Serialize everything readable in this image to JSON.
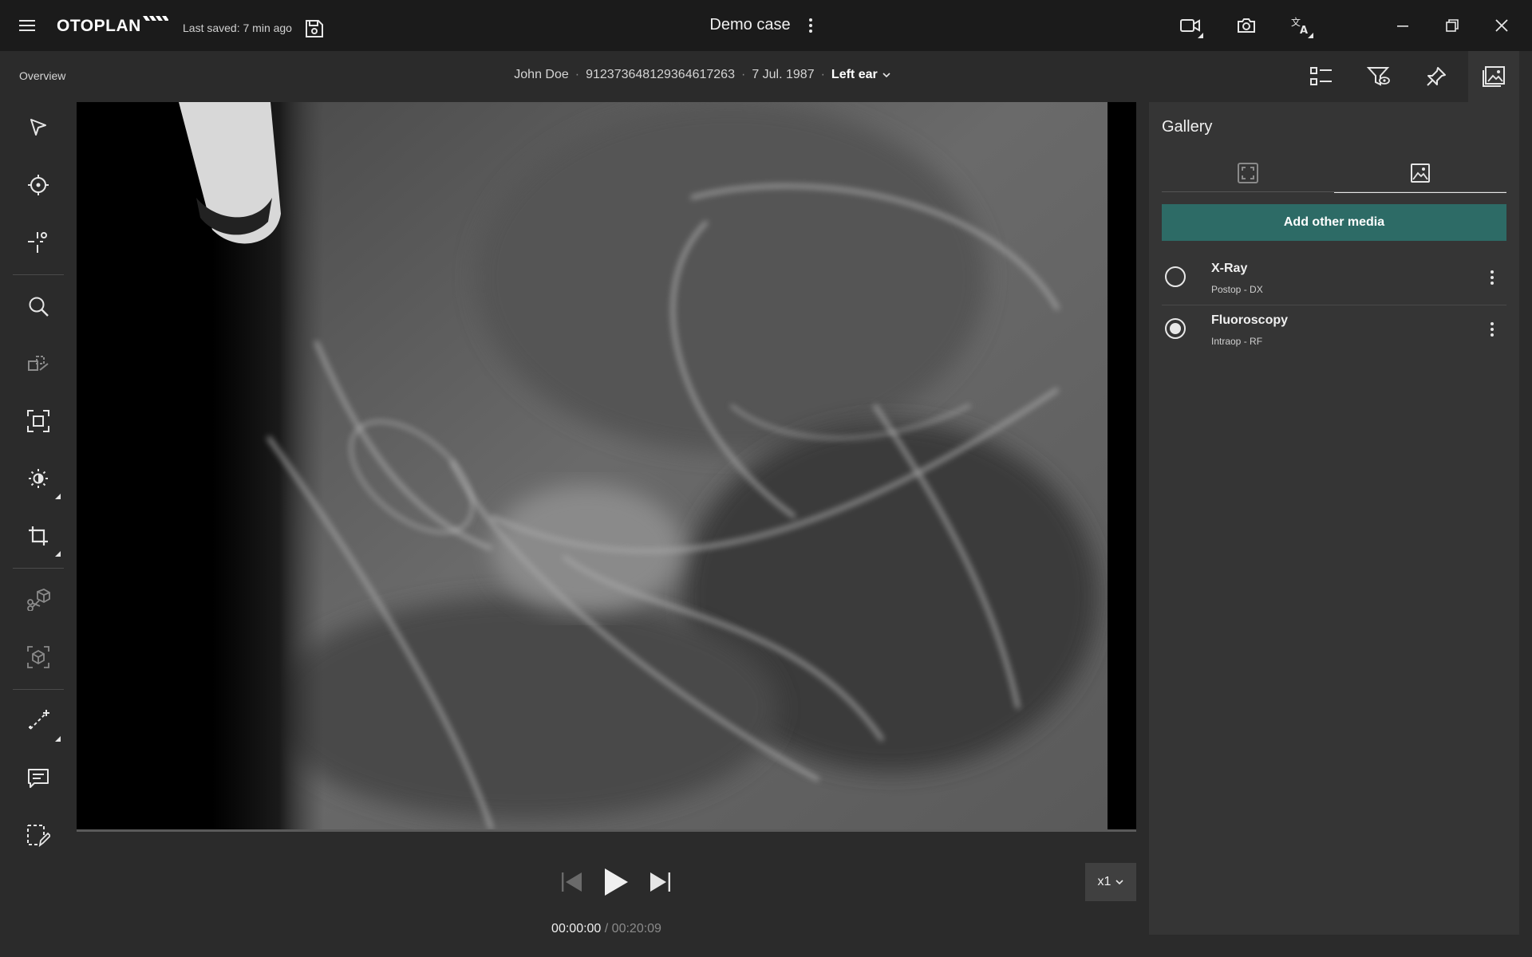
{
  "app": {
    "brand": "OTOPLAN",
    "last_saved": "Last saved: 7 min ago",
    "case_title": "Demo case"
  },
  "breadcrumb": {
    "overview": "Overview"
  },
  "patient": {
    "name": "John Doe",
    "id": "912373648129364617263",
    "dob": "7 Jul. 1987",
    "ear": "Left ear",
    "separator": "·"
  },
  "gallery": {
    "title": "Gallery",
    "add_button": "Add other media",
    "active_tab": "media",
    "items": [
      {
        "title": "X-Ray",
        "subtitle": "Postop - DX",
        "selected": false
      },
      {
        "title": "Fluoroscopy",
        "subtitle": "Intraop - RF",
        "selected": true
      }
    ]
  },
  "playback": {
    "current": "00:00:00",
    "separator": " / ",
    "total": "00:20:09",
    "speed": "x1",
    "progress": 0
  },
  "colors": {
    "accent": "#2d6b66",
    "topbar": "#1b1b1b",
    "panel": "#353535",
    "background": "#2b2b2b"
  },
  "icons": {
    "menu": "hamburger-icon",
    "save": "floppy-icon",
    "case_menu": "kebab-icon",
    "record": "video-camera-icon",
    "screenshot": "camera-icon",
    "language": "translate-icon",
    "minimize": "minimize-icon",
    "restore": "restore-icon",
    "close": "close-icon",
    "layout": "layout-list-icon",
    "visibility": "eye-filter-icon",
    "pin": "pin-icon",
    "gallery": "gallery-icon"
  }
}
